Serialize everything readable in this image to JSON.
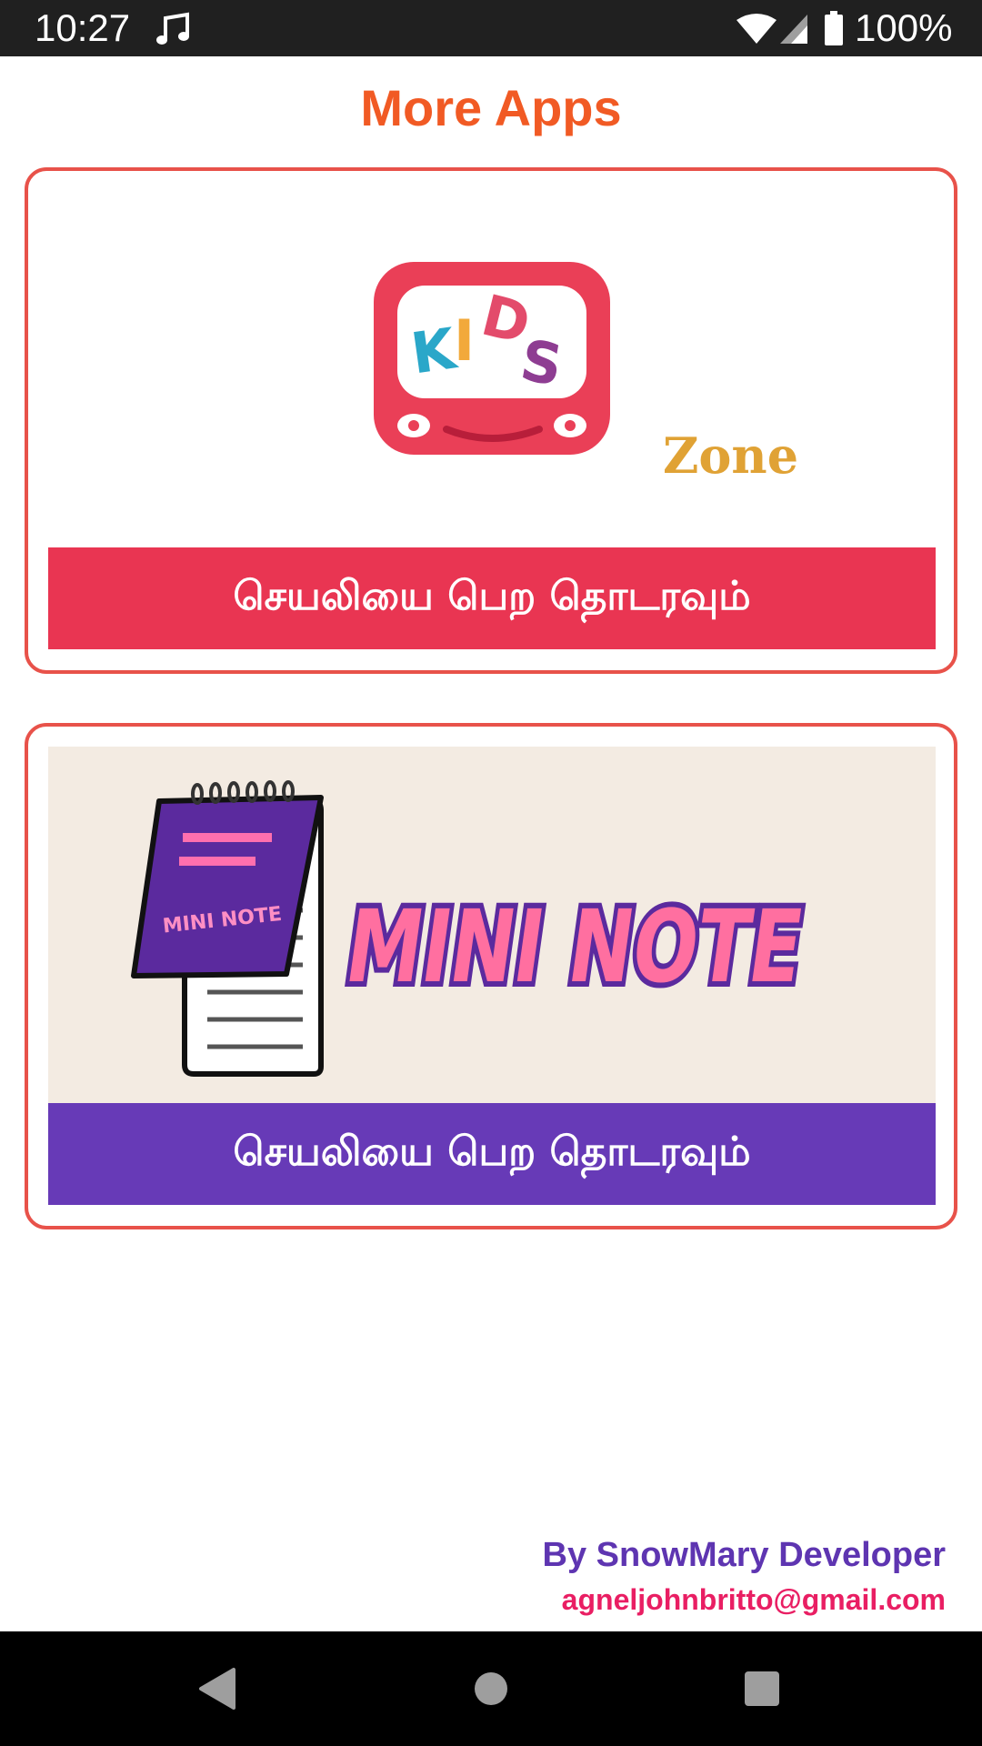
{
  "status_bar": {
    "time": "10:27",
    "battery_percent": "100%",
    "icons": [
      "music-note-icon",
      "wifi-icon",
      "cell-signal-icon",
      "battery-icon"
    ]
  },
  "page": {
    "title": "More Apps",
    "title_color": "#f15a24",
    "card_border_color": "#e8524a"
  },
  "apps": [
    {
      "logo_lettering": "KIDS Zone",
      "button_label": "செயலியை பெற தொடரவும்",
      "button_color": "#e93552"
    },
    {
      "logo_lettering": "MINI NOTE",
      "button_label": "செயலியை பெற தொடரவும்",
      "button_color": "#673ab7"
    }
  ],
  "footer": {
    "developer": "By SnowMary Developer",
    "email": "agneljohnbritto@gmail.com"
  },
  "nav_bar": {
    "icons": [
      "back-icon",
      "home-icon",
      "recents-icon"
    ]
  }
}
